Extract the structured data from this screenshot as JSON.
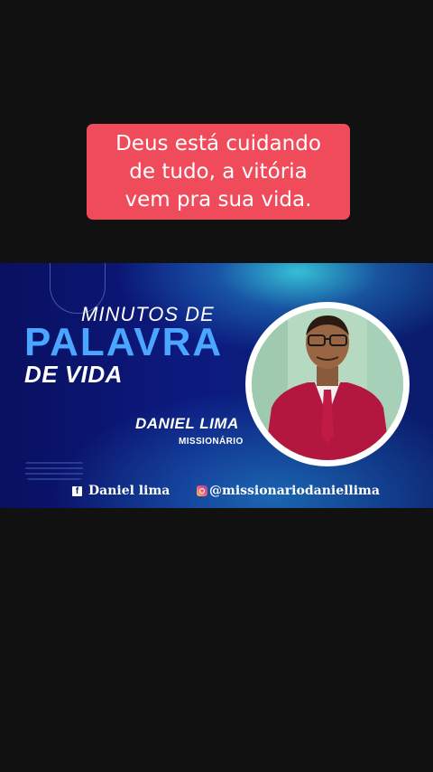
{
  "caption": {
    "lines": [
      "Deus está cuidando",
      "de tudo, a vitória",
      "vem pra sua vida."
    ]
  },
  "banner": {
    "title_top": "MINUTOS DE",
    "title_main": "PALAVRA",
    "title_bottom": "DE VIDA",
    "name": "DANIEL LIMA",
    "role": "MISSIONÁRIO",
    "facebook": "Daniel lima",
    "instagram": "@missionariodaniellima"
  },
  "colors": {
    "caption_bg": "#ef4b5b",
    "banner_bg": "#0b1c6c",
    "accent_blue": "#4aa6ff",
    "suit": "#b3163e"
  },
  "icons": [
    "facebook-icon",
    "instagram-icon"
  ]
}
